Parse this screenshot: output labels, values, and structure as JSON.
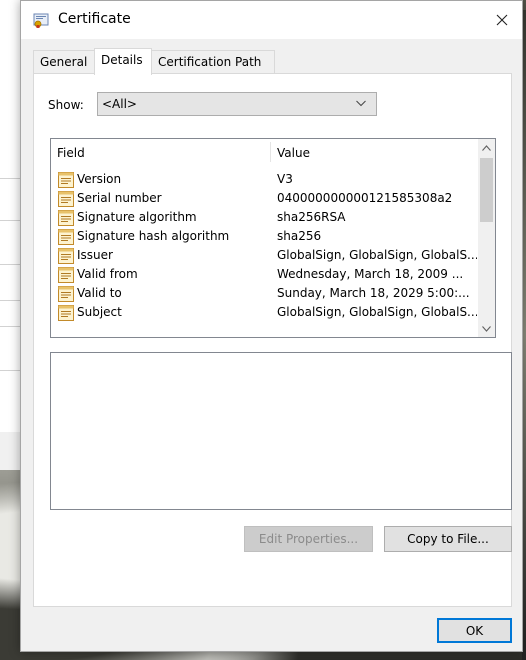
{
  "window": {
    "title": "Certificate",
    "close_glyph": "✕",
    "icon": "certificate-icon"
  },
  "tabs": [
    {
      "label": "General",
      "selected": false
    },
    {
      "label": "Details",
      "selected": true
    },
    {
      "label": "Certification Path",
      "selected": false
    }
  ],
  "show": {
    "label": "Show:",
    "selected": "<All>"
  },
  "list": {
    "headers": {
      "field": "Field",
      "value": "Value"
    },
    "rows": [
      {
        "field": "Version",
        "value": "V3"
      },
      {
        "field": "Serial number",
        "value": "040000000000121585308a2"
      },
      {
        "field": "Signature algorithm",
        "value": "sha256RSA"
      },
      {
        "field": "Signature hash algorithm",
        "value": "sha256"
      },
      {
        "field": "Issuer",
        "value": "GlobalSign, GlobalSign, GlobalS..."
      },
      {
        "field": "Valid from",
        "value": "Wednesday, March 18, 2009 ..."
      },
      {
        "field": "Valid to",
        "value": "Sunday, March 18, 2029 5:00:..."
      },
      {
        "field": "Subject",
        "value": "GlobalSign, GlobalSign, GlobalS..."
      }
    ]
  },
  "buttons": {
    "edit_properties": "Edit Properties...",
    "copy_to_file": "Copy to File...",
    "ok": "OK"
  },
  "colors": {
    "focus_border": "#0078d7",
    "disabled_text": "#8b8b8b"
  }
}
